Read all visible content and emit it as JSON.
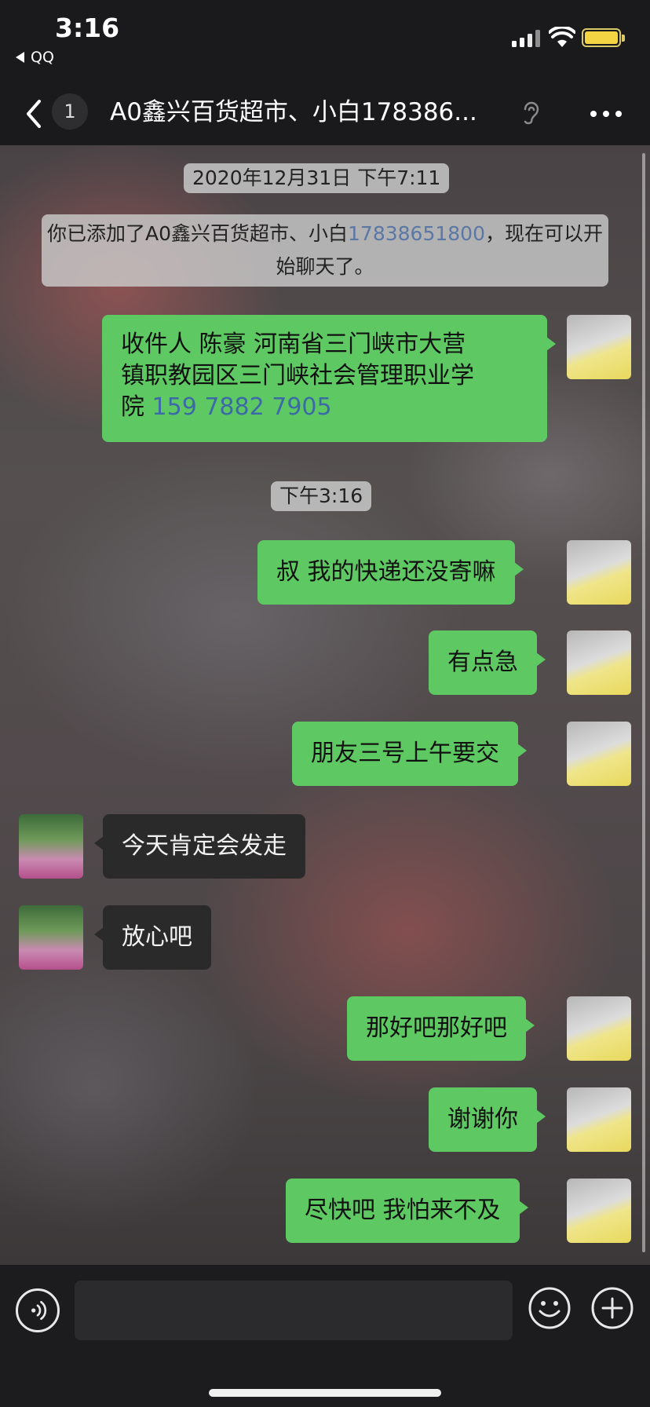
{
  "status_bar": {
    "time": "3:16",
    "back_app": "QQ"
  },
  "nav": {
    "unread_count": "1",
    "title": "A0鑫兴百货超市、小白178386..."
  },
  "system": {
    "timestamp": "2020年12月31日 下午7:11",
    "notice_prefix": "你已添加了A0鑫兴百货超市、小白",
    "notice_link": "17838651800",
    "notice_suffix": "，现在可以开始聊天了。"
  },
  "messages": [
    {
      "direction": "out",
      "line1": "收件人 陈豪 河南省三门峡市大营",
      "line2": "镇职教园区三门峡社会管理职业学",
      "line3_prefix": "院 ",
      "line3_phone": "159 7882 7905"
    },
    {
      "direction": "time",
      "text": "下午3:16"
    },
    {
      "direction": "out",
      "text": "叔 我的快递还没寄嘛"
    },
    {
      "direction": "out",
      "text": "有点急"
    },
    {
      "direction": "out",
      "text": "朋友三号上午要交"
    },
    {
      "direction": "in",
      "text": "今天肯定会发走"
    },
    {
      "direction": "in",
      "text": "放心吧"
    },
    {
      "direction": "out",
      "text": "那好吧那好吧"
    },
    {
      "direction": "out",
      "text": "谢谢你"
    },
    {
      "direction": "out",
      "text": "尽快吧 我怕来不及"
    }
  ],
  "input": {
    "value": "",
    "placeholder": ""
  },
  "icons": {
    "back": "chevron-left-icon",
    "more": "more-icon",
    "voice": "voice-icon",
    "emoji": "emoji-icon",
    "plus": "plus-icon"
  },
  "colors": {
    "outgoing_bubble": "#5ec962",
    "incoming_bubble": "#2a2a2a",
    "link": "#5a77a6"
  }
}
